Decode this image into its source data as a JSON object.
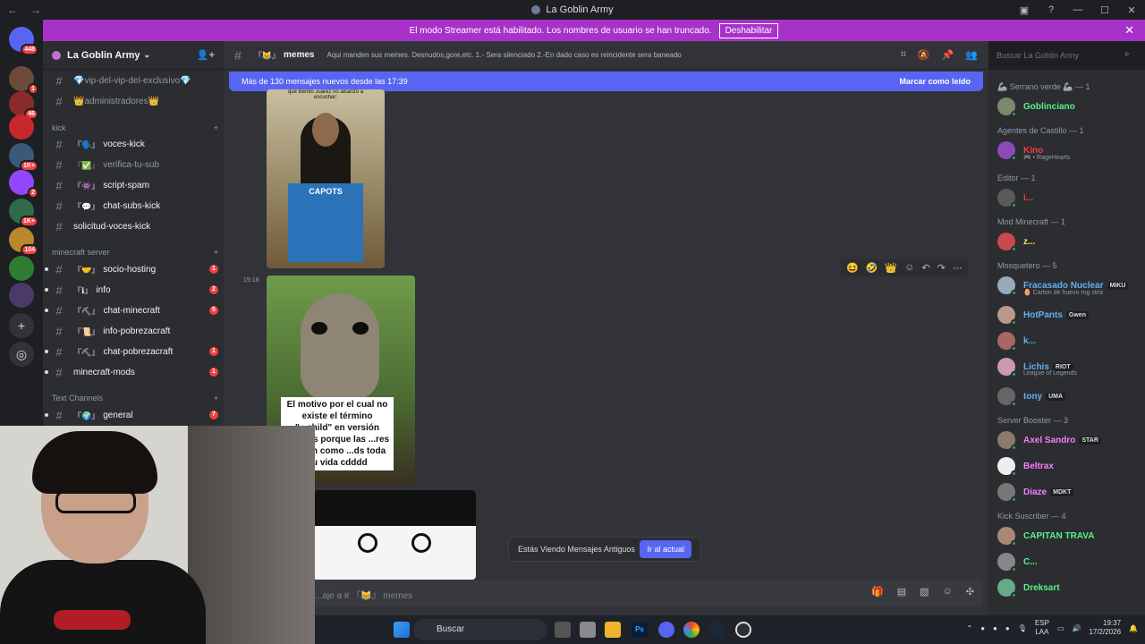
{
  "window": {
    "title": "La Goblin Army"
  },
  "banner": {
    "text": "El modo Streamer está habilitado. Los nombres de usuario se han truncado.",
    "button": "Deshabilitar"
  },
  "servers": [
    {
      "badge": "448",
      "color": "#5865f2"
    },
    {
      "badge": "1",
      "color": "#6b4a3a"
    },
    {
      "badge": "46",
      "color": "#8a2a2a"
    },
    {
      "badge": "",
      "color": "#c8282d"
    },
    {
      "badge": "1K+",
      "color": "#3a5a7a"
    },
    {
      "badge": "2",
      "color": "#9146ff"
    },
    {
      "badge": "1K+",
      "color": "#2f6a4a"
    },
    {
      "badge": "104",
      "color": "#b8892a"
    },
    {
      "badge": "",
      "color": "#2e7d32"
    },
    {
      "badge": "",
      "color": "#4a3a6a"
    }
  ],
  "guild": {
    "name": "La Goblin Army"
  },
  "channels": {
    "top": [
      {
        "label": "vip-del-vip-del-exclusivo",
        "prefix": "💎",
        "suffix": "💎"
      },
      {
        "label": "administradores",
        "prefix": "👑",
        "suffix": "👑"
      }
    ],
    "kick_category": "kick",
    "kick": [
      {
        "label": "voces-kick",
        "emoji": "『🗣️』",
        "count": ""
      },
      {
        "label": "verifica-tu-sub",
        "emoji": "『✅』",
        "count": ""
      },
      {
        "label": "script-spam",
        "emoji": "『👾』",
        "count": ""
      },
      {
        "label": "chat-subs-kick",
        "emoji": "『💬』",
        "count": ""
      },
      {
        "label": "solicitud-voces-kick",
        "emoji": "",
        "count": ""
      }
    ],
    "mc_category": "minecraft server",
    "mc": [
      {
        "label": "socio-hosting",
        "emoji": "『🤝』",
        "count": "1"
      },
      {
        "label": "info",
        "emoji": "『ℹ』",
        "count": "2"
      },
      {
        "label": "chat-minecraft",
        "emoji": "『⛏』",
        "count": "5"
      },
      {
        "label": "info-pobrezacraft",
        "emoji": "『📜』",
        "count": ""
      },
      {
        "label": "chat-pobrezacraft",
        "emoji": "『⛏』",
        "count": "1"
      },
      {
        "label": "minecraft-mods",
        "emoji": "",
        "count": "1"
      }
    ],
    "text_category": "Text Channels",
    "text": [
      {
        "label": "general",
        "emoji": "『🌍』",
        "count": "7"
      }
    ]
  },
  "chat": {
    "channel": "memes",
    "channel_emoji": "『😹』",
    "topic": "Aqui manden sus memes. Desnudos,gore,etc. 1.- Sera silenciado 2.-En dado caso es reincidente sera baneado",
    "search_placeholder": "Buscar La Goblin Army",
    "new_messages": "Más de 130 mensajes nuevos desde las 17:39",
    "mark_read": "Marcar como leído",
    "image1_caption": "que Benito Juárez no alcanzó a escuchar:",
    "image1_poster": "CAPOTS",
    "time": "19:18",
    "image2_caption": "El motivo por el cual no existe el término \"...child\" en versión ...ina es porque las ...res actúan como ...ds toda su vida cdddd",
    "old_messages": "Estás Viendo Mensajes Antiguos",
    "jump": "Ir al actual",
    "composer_placeholder": "...aje a # 『😹』 memes"
  },
  "members": [
    {
      "group": "🦾 Serrano verde 🦾 — 1",
      "items": [
        {
          "name": "Goblinciano",
          "color": "#57f287",
          "tag": "",
          "sub": "",
          "av": "#7a8a6a"
        }
      ]
    },
    {
      "group": "Agentes de Castillo — 1",
      "items": [
        {
          "name": "Kino",
          "color": "#f23f43",
          "tag": "",
          "sub": "🎮 • RageHearts",
          "av": "#8a4ab8"
        }
      ]
    },
    {
      "group": "Editor — 1",
      "items": [
        {
          "name": "i...",
          "color": "#f23f43",
          "tag": "",
          "sub": "",
          "av": "#5a5a5a"
        }
      ]
    },
    {
      "group": "Mod Minecraft — 1",
      "items": [
        {
          "name": "z...",
          "color": "#fee75c",
          "tag": "",
          "sub": "",
          "av": "#c84a4a"
        }
      ]
    },
    {
      "group": "Mosquetero — 5",
      "items": [
        {
          "name": "Fracasado Nuclear",
          "color": "#5fb0f2",
          "tag": "MIKU",
          "sub": "🥚 Carton de huevo rog strix",
          "av": "#9ab"
        },
        {
          "name": "HotPants",
          "color": "#5fb0f2",
          "tag": "Gwen",
          "sub": "",
          "av": "#b98"
        },
        {
          "name": "k...",
          "color": "#5fb0f2",
          "tag": "",
          "sub": "",
          "av": "#a66"
        },
        {
          "name": "Lichis",
          "color": "#5fb0f2",
          "tag": "RIOT",
          "sub": "League of Legends",
          "av": "#c9a"
        },
        {
          "name": "tony",
          "color": "#5fb0f2",
          "tag": "UMA",
          "sub": "",
          "av": "#666"
        }
      ]
    },
    {
      "group": "Server Booster — 3",
      "items": [
        {
          "name": "Axel Sandro",
          "color": "#f47fff",
          "tag": "STAR",
          "sub": "",
          "av": "#8a7a6a"
        },
        {
          "name": "Beltrax",
          "color": "#f47fff",
          "tag": "",
          "sub": "",
          "av": "#eee"
        },
        {
          "name": "Diaze",
          "color": "#f47fff",
          "tag": "MDKT",
          "sub": "",
          "av": "#777"
        }
      ]
    },
    {
      "group": "Kick Suscriber — 4",
      "items": [
        {
          "name": "CAPITAN TRAVA",
          "color": "#57f287",
          "tag": "",
          "sub": "",
          "av": "#a87"
        },
        {
          "name": "C...",
          "color": "#57f287",
          "tag": "",
          "sub": "",
          "av": "#888"
        },
        {
          "name": "Dreksart",
          "color": "#57f287",
          "tag": "",
          "sub": "",
          "av": "#6a8"
        }
      ]
    }
  ],
  "taskbar": {
    "search": "Buscar",
    "lang1": "ESP",
    "lang2": "LAA",
    "time": "19:37",
    "date": "17/2/2026"
  }
}
